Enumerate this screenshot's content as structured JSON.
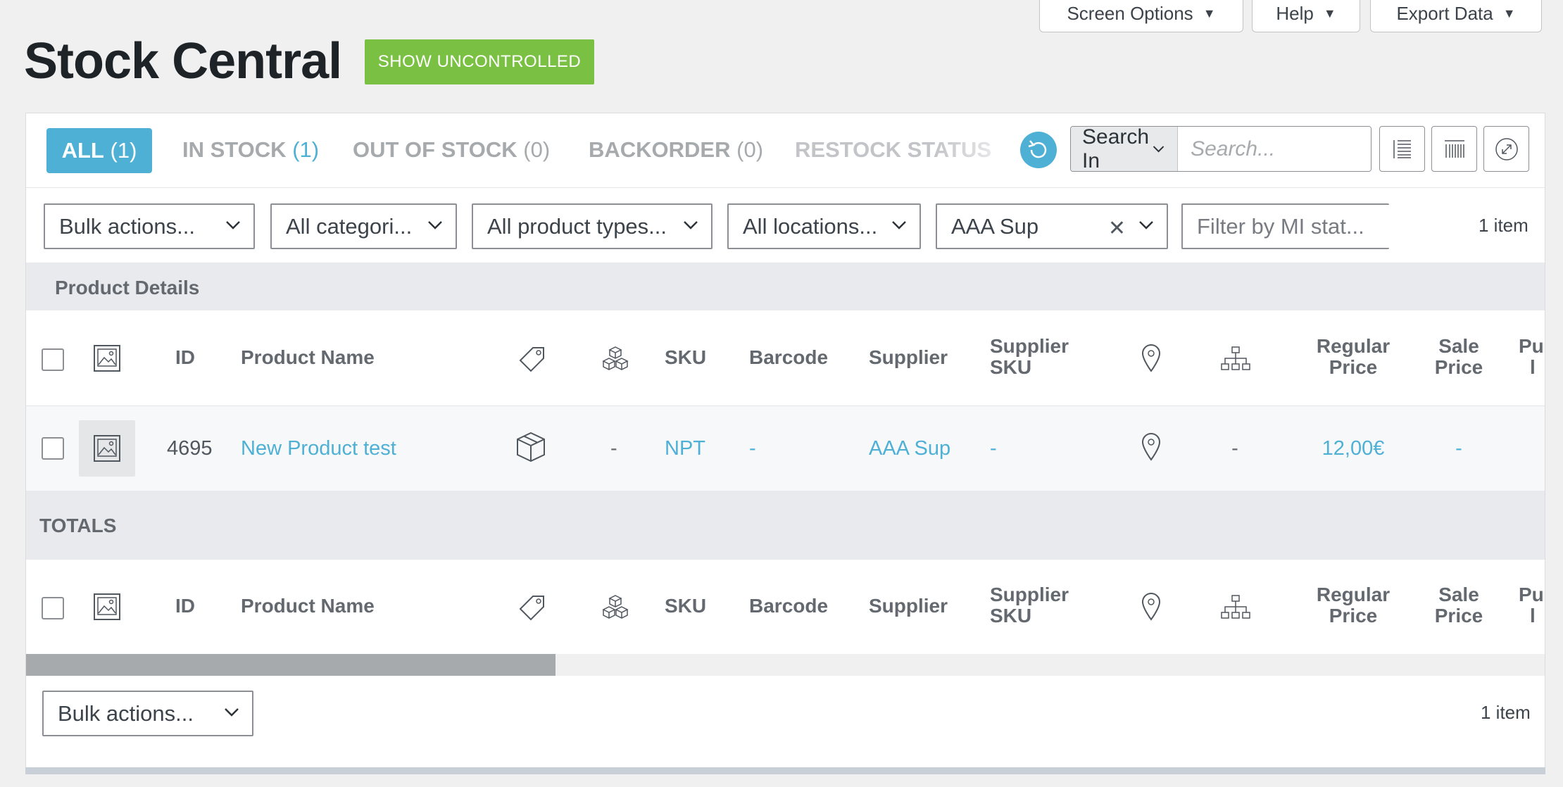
{
  "meta": {
    "screen_options": "Screen Options",
    "help": "Help",
    "export_data": "Export Data"
  },
  "header": {
    "title": "Stock Central",
    "show_uncontrolled": "SHOW UNCONTROLLED"
  },
  "tabs": [
    {
      "label": "ALL",
      "count": "(1)"
    },
    {
      "label": "IN STOCK",
      "count": "(1)"
    },
    {
      "label": "OUT OF STOCK",
      "count": "(0)"
    },
    {
      "label": "BACKORDER",
      "count": "(0)"
    },
    {
      "label": "RESTOCK STATUS"
    }
  ],
  "search": {
    "search_in": "Search In",
    "placeholder": "Search..."
  },
  "filters": {
    "bulk_actions": "Bulk actions...",
    "categories": "All categori...",
    "product_types": "All product types...",
    "locations": "All locations...",
    "supplier": "AAA Sup",
    "mi_status": "Filter by MI stat..."
  },
  "item_count": "1 item",
  "section_label": "Product Details",
  "totals_label": "TOTALS",
  "columns": {
    "id": "ID",
    "product_name": "Product Name",
    "sku": "SKU",
    "barcode": "Barcode",
    "supplier": "Supplier",
    "supplier_sku": [
      "Supplier",
      "SKU"
    ],
    "regular_price": [
      "Regular",
      "Price"
    ],
    "sale_price": [
      "Sale",
      "Price"
    ],
    "purchase_price_partial": [
      "Pu",
      "l"
    ]
  },
  "rows": [
    {
      "id": "4695",
      "product_name": "New Product test",
      "type": "-",
      "sku": "NPT",
      "barcode": "-",
      "supplier": "AAA Sup",
      "supplier_sku": "-",
      "hierarchy": "-",
      "regular_price": "12,00€",
      "sale_price": "-"
    }
  ],
  "bottom": {
    "bulk_actions": "Bulk actions...",
    "item_count": "1 item"
  },
  "colors": {
    "accent": "#4fb0d6",
    "green": "#7ac143"
  }
}
